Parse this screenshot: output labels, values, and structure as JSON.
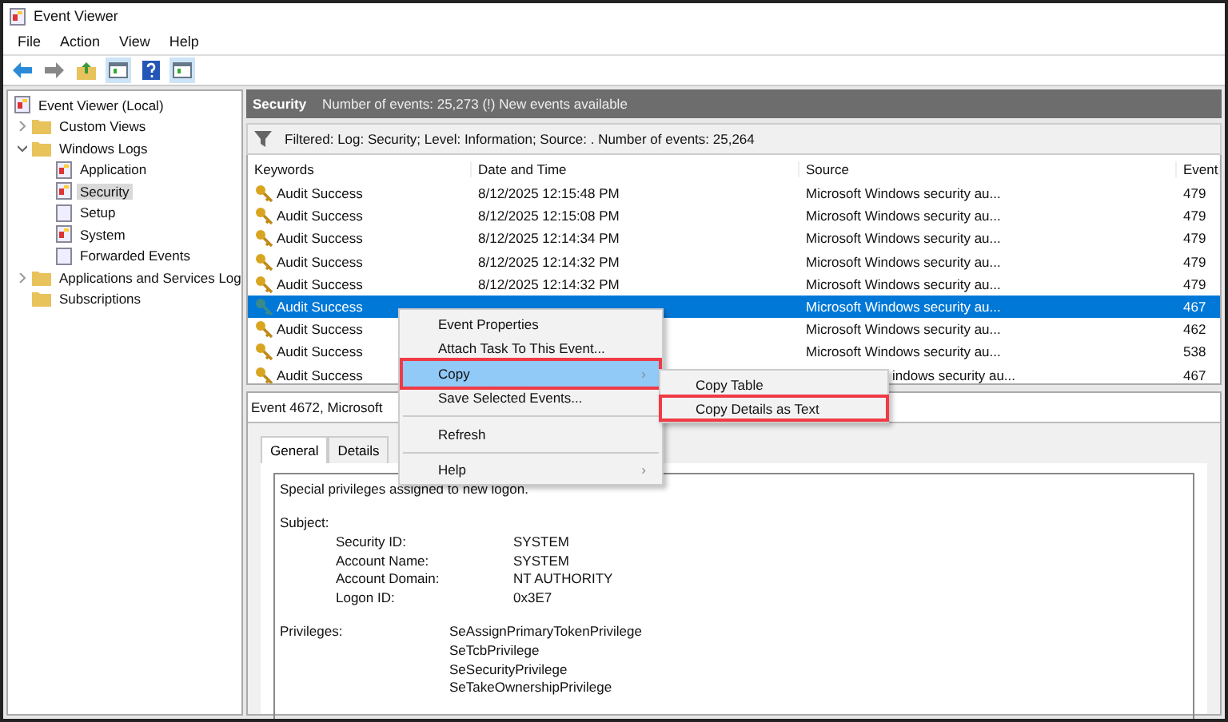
{
  "window": {
    "title": "Event Viewer"
  },
  "menu": [
    "File",
    "Action",
    "View",
    "Help"
  ],
  "toolbar": [
    {
      "kind": "back"
    },
    {
      "kind": "forward"
    },
    {
      "kind": "up"
    },
    {
      "kind": "pane"
    },
    {
      "kind": "help"
    },
    {
      "kind": "pane"
    }
  ],
  "tree": [
    {
      "label": "Event Viewer (Local)",
      "kind": "log",
      "selected": false,
      "children": [
        {
          "label": "Custom Views",
          "kind": "folder",
          "selected": false,
          "expanded": false
        },
        {
          "label": "Windows Logs",
          "kind": "folder",
          "selected": false,
          "expanded": true,
          "children": [
            {
              "label": "Application",
              "kind": "log",
              "selected": false
            },
            {
              "label": "Security",
              "kind": "log",
              "selected": true
            },
            {
              "label": "Setup",
              "kind": "page",
              "selected": false
            },
            {
              "label": "System",
              "kind": "log",
              "selected": false
            },
            {
              "label": "Forwarded Events",
              "kind": "page",
              "selected": false
            }
          ]
        },
        {
          "label": "Applications and Services Log",
          "kind": "folder",
          "selected": false,
          "expanded": false
        },
        {
          "label": "Subscriptions",
          "kind": "folder",
          "selected": false
        }
      ]
    }
  ],
  "header": {
    "title": "Security",
    "info": "Number of events: 25,273 (!) New events available"
  },
  "filter": "Filtered: Log: Security; Level: Information; Source: . Number of events: 25,264",
  "table": {
    "columns": [
      "Keywords",
      "Date and Time",
      "Source",
      "Event"
    ],
    "rows": [
      {
        "keyword": "Audit Success",
        "date": "8/12/2025 12:15:48 PM",
        "source": "Microsoft Windows security au...",
        "event_id": "479",
        "selected": false
      },
      {
        "keyword": "Audit Success",
        "date": "8/12/2025 12:15:08 PM",
        "source": "Microsoft Windows security au...",
        "event_id": "479",
        "selected": false
      },
      {
        "keyword": "Audit Success",
        "date": "8/12/2025 12:14:34 PM",
        "source": "Microsoft Windows security au...",
        "event_id": "479",
        "selected": false
      },
      {
        "keyword": "Audit Success",
        "date": "8/12/2025 12:14:32 PM",
        "source": "Microsoft Windows security au...",
        "event_id": "479",
        "selected": false
      },
      {
        "keyword": "Audit Success",
        "date": "8/12/2025 12:14:32 PM",
        "source": "Microsoft Windows security au...",
        "event_id": "479",
        "selected": false
      },
      {
        "keyword": "Audit Success",
        "source": "Microsoft Windows security au...",
        "event_id": "467",
        "selected": true
      },
      {
        "keyword": "Audit Success",
        "source": "Microsoft Windows security au...",
        "event_id": "462",
        "selected": false
      },
      {
        "keyword": "Audit Success",
        "source": "Microsoft Windows security au...",
        "event_id": "538",
        "selected": false
      },
      {
        "keyword": "Audit Success",
        "source_tail": "indows security au...",
        "event_id": "467",
        "selected": false
      }
    ]
  },
  "detail": {
    "title": "Event 4672, Microsoft",
    "tabs": [
      {
        "label": "General",
        "selected": true
      },
      {
        "label": "Details",
        "selected": false
      }
    ],
    "summary": "Special privileges assigned to new logon.",
    "subject_label": "Subject:",
    "fields": [
      {
        "name": "Security ID:",
        "value": "SYSTEM"
      },
      {
        "name": "Account Name:",
        "value": "SYSTEM"
      },
      {
        "name": "Account Domain:",
        "value": "NT AUTHORITY"
      },
      {
        "name": "Logon ID:",
        "value": "0x3E7"
      }
    ],
    "privileges_label": "Privileges:",
    "privileges": [
      "SeAssignPrimaryTokenPrivilege",
      "SeTcbPrivilege",
      "SeSecurityPrivilege",
      "SeTakeOwnershipPrivilege"
    ]
  },
  "context_menu": {
    "items": [
      {
        "label": "Event Properties",
        "kind": "item",
        "selected": false,
        "highlighted": false,
        "submenu": false
      },
      {
        "label": "Attach Task To This Event...",
        "kind": "item",
        "selected": false,
        "highlighted": false,
        "submenu": false
      },
      {
        "label": "Copy",
        "kind": "item",
        "selected": true,
        "highlighted": true,
        "submenu": true
      },
      {
        "label": "Save Selected Events...",
        "kind": "item",
        "selected": false,
        "highlighted": false,
        "submenu": false
      },
      {
        "kind": "separator"
      },
      {
        "label": "Refresh",
        "kind": "item",
        "selected": false,
        "highlighted": false,
        "submenu": false
      },
      {
        "kind": "separator"
      },
      {
        "label": "Help",
        "kind": "item",
        "selected": false,
        "highlighted": false,
        "submenu": true
      }
    ],
    "arrow": "›",
    "submenu": [
      {
        "label": "Copy Table",
        "highlighted": false
      },
      {
        "label": "Copy Details as Text",
        "highlighted": true
      }
    ]
  }
}
